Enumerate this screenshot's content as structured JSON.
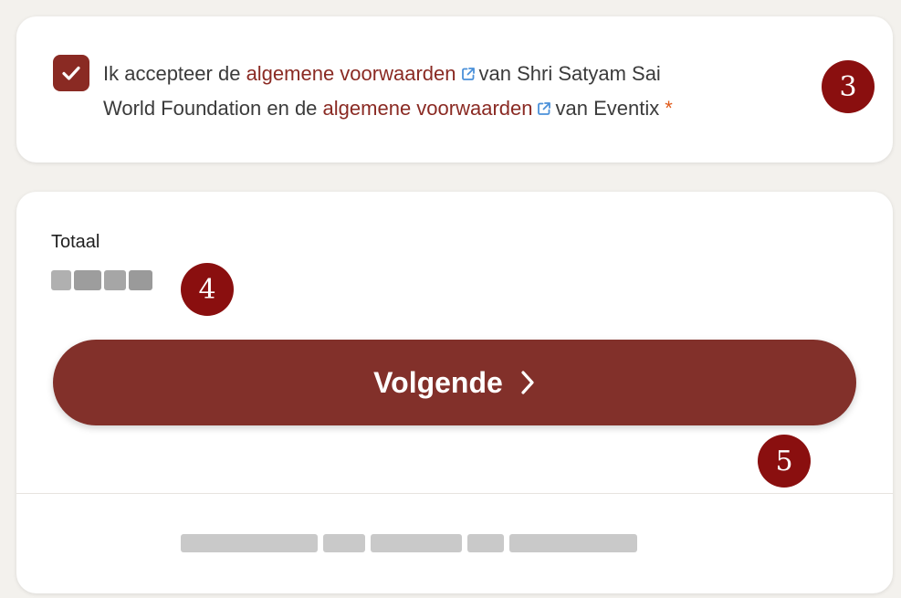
{
  "terms": {
    "checked": true,
    "prefix": "Ik accepteer de",
    "link1": "algemene voorwaarden",
    "middle1": "van Shri Satyam Sai",
    "middle2": "World Foundation en de",
    "link2": "algemene voorwaarden",
    "suffix": "van Eventix",
    "required_mark": "*"
  },
  "total": {
    "label": "Totaal",
    "amount_redacted": true
  },
  "next_button": {
    "label": "Volgende",
    "icon": "chevron-right-icon"
  },
  "footer": {
    "powered_by_redacted": true
  },
  "annotations": {
    "badge3": "3",
    "badge4": "4",
    "badge5": "5"
  },
  "colors": {
    "accent": "#82302a",
    "link": "#8a2a23",
    "badge": "#8a0f0f",
    "required": "#e05a1a",
    "external_icon": "#4a90d9"
  }
}
